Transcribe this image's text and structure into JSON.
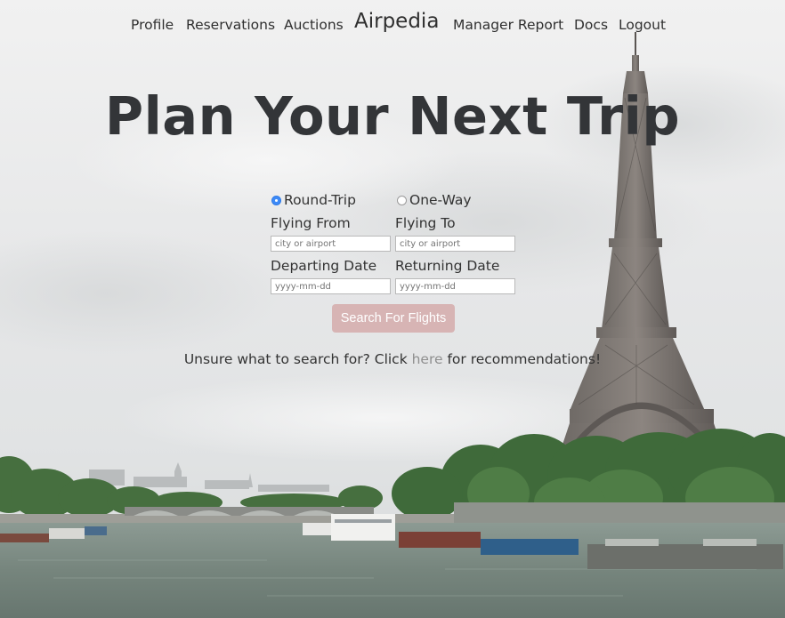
{
  "nav": {
    "profile": "Profile",
    "reservations": "Reservations",
    "auctions": "Auctions",
    "brand": "Airpedia",
    "manager_report": "Manager Report",
    "docs": "Docs",
    "logout": "Logout"
  },
  "hero": {
    "title": "Plan Your Next Trip"
  },
  "search": {
    "trip_type": {
      "round_trip": "Round-Trip",
      "one_way": "One-Way",
      "selected": "Round-Trip"
    },
    "flying_from": {
      "label": "Flying From",
      "placeholder": "city or airport",
      "value": ""
    },
    "flying_to": {
      "label": "Flying To",
      "placeholder": "city or airport",
      "value": ""
    },
    "departing_date": {
      "label": "Departing Date",
      "placeholder": "yyyy-mm-dd",
      "value": ""
    },
    "returning_date": {
      "label": "Returning Date",
      "placeholder": "yyyy-mm-dd",
      "value": ""
    },
    "button_label": "Search For Flights"
  },
  "recommendation": {
    "prefix": "Unsure what to search for? Click ",
    "link": "here",
    "suffix": " for recommendations!"
  },
  "colors": {
    "button_bg": "#d7b4b4",
    "radio_selected": "#3d8af7",
    "link": "#8f8f8f",
    "text": "#333333"
  }
}
